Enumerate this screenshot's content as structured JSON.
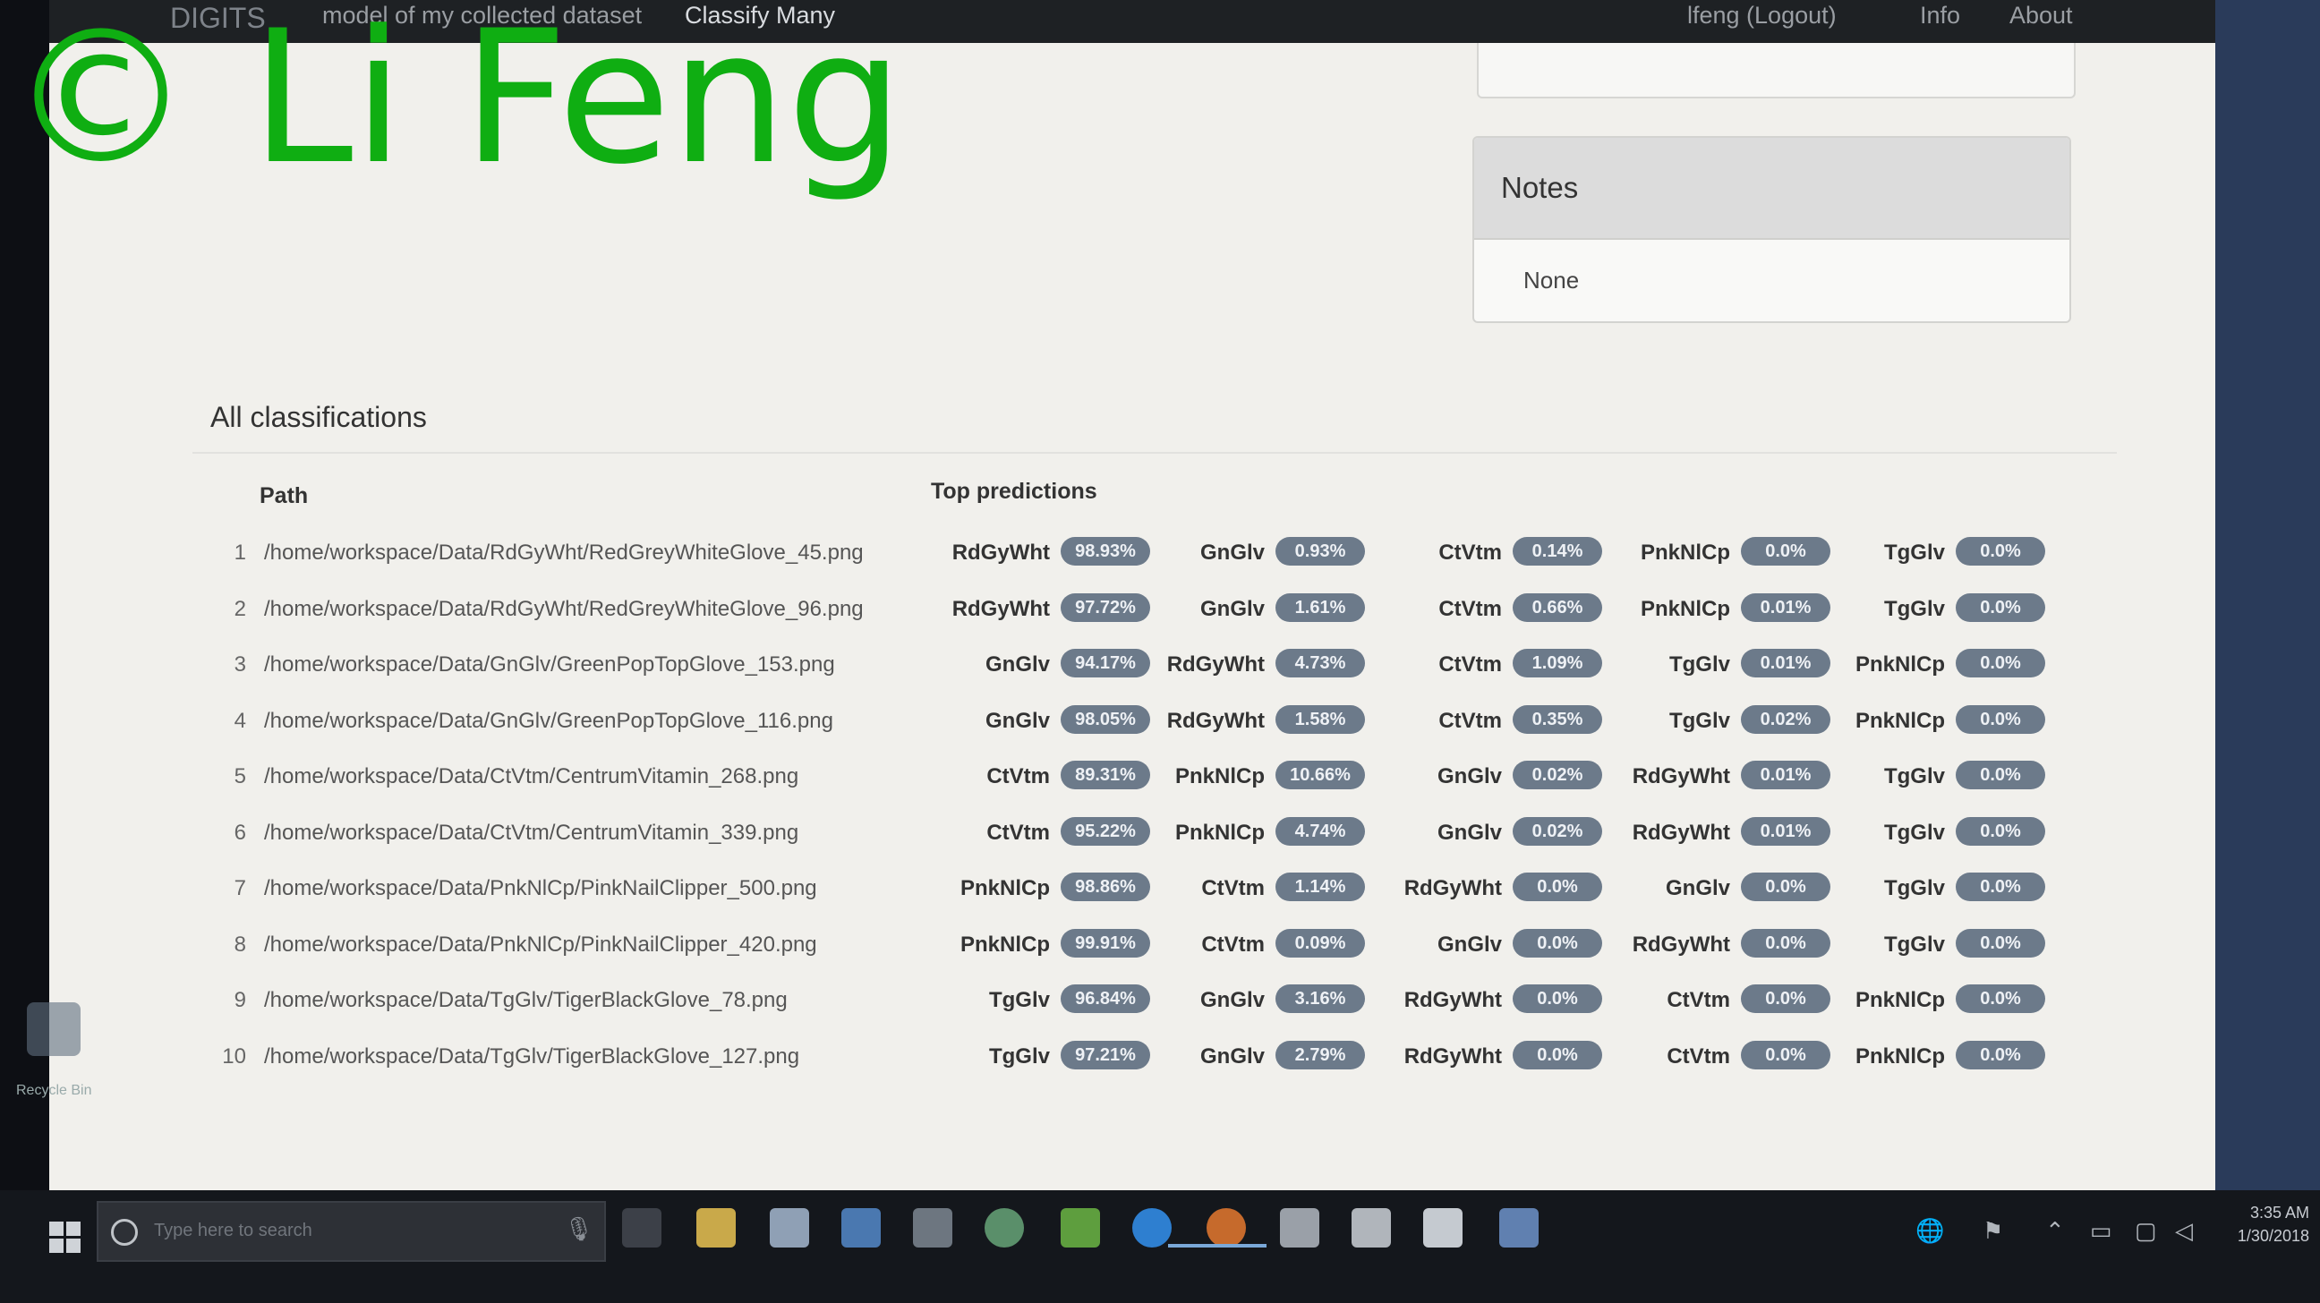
{
  "navbar": {
    "brand": "DIGITS",
    "model": "model of my collected dataset",
    "classify": "Classify Many",
    "user": "lfeng (Logout)",
    "info": "Info",
    "about": "About"
  },
  "notes": {
    "heading": "Notes",
    "body": "None"
  },
  "section_title": "All classifications",
  "columns": {
    "path": "Path",
    "top": "Top predictions"
  },
  "rows": [
    {
      "idx": "1",
      "path": "/home/workspace/Data/RdGyWht/RedGreyWhiteGlove_45.png",
      "preds": [
        [
          "RdGyWht",
          "98.93%"
        ],
        [
          "GnGlv",
          "0.93%"
        ],
        [
          "CtVtm",
          "0.14%"
        ],
        [
          "PnkNlCp",
          "0.0%"
        ],
        [
          "TgGlv",
          "0.0%"
        ]
      ]
    },
    {
      "idx": "2",
      "path": "/home/workspace/Data/RdGyWht/RedGreyWhiteGlove_96.png",
      "preds": [
        [
          "RdGyWht",
          "97.72%"
        ],
        [
          "GnGlv",
          "1.61%"
        ],
        [
          "CtVtm",
          "0.66%"
        ],
        [
          "PnkNlCp",
          "0.01%"
        ],
        [
          "TgGlv",
          "0.0%"
        ]
      ]
    },
    {
      "idx": "3",
      "path": "/home/workspace/Data/GnGlv/GreenPopTopGlove_153.png",
      "preds": [
        [
          "GnGlv",
          "94.17%"
        ],
        [
          "RdGyWht",
          "4.73%"
        ],
        [
          "CtVtm",
          "1.09%"
        ],
        [
          "TgGlv",
          "0.01%"
        ],
        [
          "PnkNlCp",
          "0.0%"
        ]
      ]
    },
    {
      "idx": "4",
      "path": "/home/workspace/Data/GnGlv/GreenPopTopGlove_116.png",
      "preds": [
        [
          "GnGlv",
          "98.05%"
        ],
        [
          "RdGyWht",
          "1.58%"
        ],
        [
          "CtVtm",
          "0.35%"
        ],
        [
          "TgGlv",
          "0.02%"
        ],
        [
          "PnkNlCp",
          "0.0%"
        ]
      ]
    },
    {
      "idx": "5",
      "path": "/home/workspace/Data/CtVtm/CentrumVitamin_268.png",
      "preds": [
        [
          "CtVtm",
          "89.31%"
        ],
        [
          "PnkNlCp",
          "10.66%"
        ],
        [
          "GnGlv",
          "0.02%"
        ],
        [
          "RdGyWht",
          "0.01%"
        ],
        [
          "TgGlv",
          "0.0%"
        ]
      ]
    },
    {
      "idx": "6",
      "path": "/home/workspace/Data/CtVtm/CentrumVitamin_339.png",
      "preds": [
        [
          "CtVtm",
          "95.22%"
        ],
        [
          "PnkNlCp",
          "4.74%"
        ],
        [
          "GnGlv",
          "0.02%"
        ],
        [
          "RdGyWht",
          "0.01%"
        ],
        [
          "TgGlv",
          "0.0%"
        ]
      ]
    },
    {
      "idx": "7",
      "path": "/home/workspace/Data/PnkNlCp/PinkNailClipper_500.png",
      "preds": [
        [
          "PnkNlCp",
          "98.86%"
        ],
        [
          "CtVtm",
          "1.14%"
        ],
        [
          "RdGyWht",
          "0.0%"
        ],
        [
          "GnGlv",
          "0.0%"
        ],
        [
          "TgGlv",
          "0.0%"
        ]
      ]
    },
    {
      "idx": "8",
      "path": "/home/workspace/Data/PnkNlCp/PinkNailClipper_420.png",
      "preds": [
        [
          "PnkNlCp",
          "99.91%"
        ],
        [
          "CtVtm",
          "0.09%"
        ],
        [
          "GnGlv",
          "0.0%"
        ],
        [
          "RdGyWht",
          "0.0%"
        ],
        [
          "TgGlv",
          "0.0%"
        ]
      ]
    },
    {
      "idx": "9",
      "path": "/home/workspace/Data/TgGlv/TigerBlackGlove_78.png",
      "preds": [
        [
          "TgGlv",
          "96.84%"
        ],
        [
          "GnGlv",
          "3.16%"
        ],
        [
          "RdGyWht",
          "0.0%"
        ],
        [
          "CtVtm",
          "0.0%"
        ],
        [
          "PnkNlCp",
          "0.0%"
        ]
      ]
    },
    {
      "idx": "10",
      "path": "/home/workspace/Data/TgGlv/TigerBlackGlove_127.png",
      "preds": [
        [
          "TgGlv",
          "97.21%"
        ],
        [
          "GnGlv",
          "2.79%"
        ],
        [
          "RdGyWht",
          "0.0%"
        ],
        [
          "CtVtm",
          "0.0%"
        ],
        [
          "PnkNlCp",
          "0.0%"
        ]
      ]
    }
  ],
  "taskbar": {
    "search_placeholder": "Type here to search",
    "clock_time": "3:35 AM",
    "clock_date": "1/30/2018"
  },
  "desktop": {
    "recycle_label": "Recycle Bin"
  },
  "watermark": "© Li Feng",
  "colors": {
    "badge": "#6c7a8a",
    "watermark": "#0fae12",
    "navbar": "#1e2124"
  }
}
